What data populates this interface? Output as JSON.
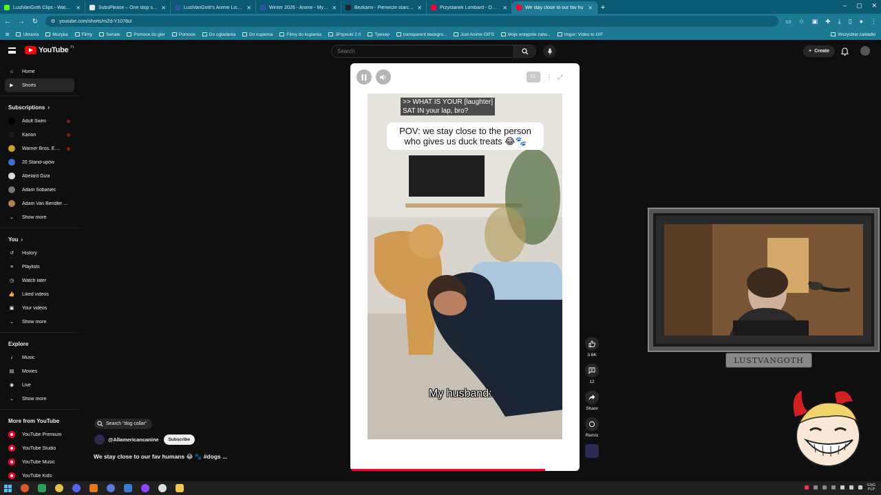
{
  "browser": {
    "tabs": [
      {
        "title": "LustVanGoth Clips - Watch Liv",
        "favicon_color": "#53fc18"
      },
      {
        "title": "SubsPlease – One stop shop fo",
        "favicon_color": "#e8e8e8"
      },
      {
        "title": "LustVanGoth's Anime List - My",
        "favicon_color": "#2e51a2"
      },
      {
        "title": "Winter 2026 - Anime - MyAnim",
        "favicon_color": "#2e51a2"
      },
      {
        "title": "Bezkarni - Pierwsze starcie / Th",
        "favicon_color": "#222222"
      },
      {
        "title": "Przystanek Lombard - Odc. 78",
        "favicon_color": "#ff0033"
      },
      {
        "title": "We stay close to our fav hu",
        "favicon_color": "#ff0033",
        "active": true
      }
    ],
    "new_tab": "+",
    "window_controls": [
      "–",
      "▢",
      "✕"
    ],
    "url": "youtube.com/shorts/mZd-Y1078uI",
    "bookmarks": [
      "Ubrania",
      "Muzyka",
      "Filmy",
      "Seriale",
      "Pomoce do gier",
      "Pomoce",
      "Do ogladania",
      "Do kupienia",
      "Filmy do kupienia",
      "JPopsuki 2.0",
      "Tpexep",
      "transparent backgro...",
      "Just Anime GIFS",
      "Moje wstępnie zatw...",
      "Imgur: Video to GIF"
    ],
    "bookmarks_right": "Wszystkie zakładki"
  },
  "youtube": {
    "logo": "YouTube",
    "country": "PL",
    "search_placeholder": "Search",
    "create_label": "Create"
  },
  "sidebar": {
    "main": [
      {
        "label": "Home",
        "icon": "home-icon"
      },
      {
        "label": "Shorts",
        "icon": "shorts-icon",
        "active": true
      }
    ],
    "subscriptions_title": "Subscriptions",
    "subscriptions": [
      {
        "label": "Adult Swim",
        "color": "#000000",
        "live": true
      },
      {
        "label": "Kanon",
        "color": "#1a1a1a",
        "live": true
      },
      {
        "label": "Warner Bros. Ent...",
        "color": "#c9a227",
        "live": true
      },
      {
        "label": "20 Stand-upów",
        "color": "#3a6fd8"
      },
      {
        "label": "Abelard Giza",
        "color": "#dddddd"
      },
      {
        "label": "Adam Sobaniec",
        "color": "#777777"
      },
      {
        "label": "Adam Van Bendler ...",
        "color": "#b08050"
      }
    ],
    "show_more": "Show more",
    "you_title": "You",
    "you": [
      {
        "label": "History",
        "icon": "history-icon"
      },
      {
        "label": "Playlists",
        "icon": "playlists-icon"
      },
      {
        "label": "Watch later",
        "icon": "clock-icon"
      },
      {
        "label": "Liked videos",
        "icon": "thumbs-up-icon"
      },
      {
        "label": "Your videos",
        "icon": "video-icon"
      },
      {
        "label": "Show more",
        "icon": "chevron-down-icon"
      }
    ],
    "explore_title": "Explore",
    "explore": [
      {
        "label": "Music",
        "icon": "music-icon"
      },
      {
        "label": "Movies",
        "icon": "film-icon"
      },
      {
        "label": "Live",
        "icon": "live-icon"
      },
      {
        "label": "Show more",
        "icon": "chevron-down-icon"
      }
    ],
    "more_title": "More from YouTube",
    "more": [
      {
        "label": "YouTube Premium"
      },
      {
        "label": "YouTube Studio"
      },
      {
        "label": "YouTube Music"
      },
      {
        "label": "YouTube Kids"
      }
    ]
  },
  "short": {
    "caption_top": ">> WHAT IS YOUR [laughter]\nSAT IN your lap, bro?",
    "bubble_text": "POV: we stay close to the person who gives us duck treats 😂🐾",
    "caption_bottom": "My husband:",
    "progress_fraction": 0.85,
    "search_chip": "Search \"dog collar\"",
    "channel": "@Allamericancanine",
    "subscribe": "Subscribe",
    "title": "We stay close to our fav humans 😂 🐾 #dogs ...",
    "likes": "3.6K",
    "comments": "12",
    "share": "Share",
    "remix": "Remix"
  },
  "overlay": {
    "streamer_label": "LUSTVANGOTH"
  },
  "tray": {
    "lang": "ENG",
    "layout": "PLP"
  }
}
